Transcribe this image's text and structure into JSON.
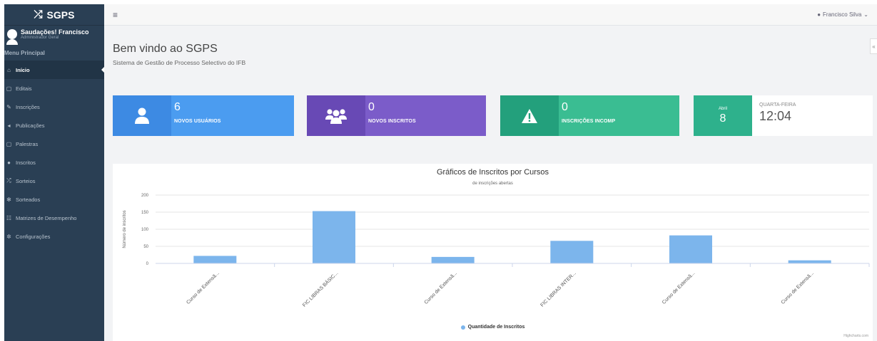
{
  "app": {
    "brand": "SGPS"
  },
  "sidebar": {
    "greeting": "Saudações! Francisco",
    "role": "Administrador Geral",
    "menu_title": "Menu Principal",
    "items": [
      {
        "label": "Início",
        "icon": "home-icon",
        "active": true
      },
      {
        "label": "Editais",
        "icon": "file-icon"
      },
      {
        "label": "Inscrições",
        "icon": "edit-icon"
      },
      {
        "label": "Publicações",
        "icon": "megaphone-icon"
      },
      {
        "label": "Palestras",
        "icon": "file-icon"
      },
      {
        "label": "Inscritos",
        "icon": "users-icon"
      },
      {
        "label": "Sorteios",
        "icon": "shuffle-icon"
      },
      {
        "label": "Sorteados",
        "icon": "gear-icon"
      },
      {
        "label": "Matrizes de Desempenho",
        "icon": "table-icon"
      },
      {
        "label": "Configurações",
        "icon": "cogs-icon"
      }
    ]
  },
  "header": {
    "user": "Francisco Silva"
  },
  "page": {
    "title": "Bem vindo ao SGPS",
    "subtitle": "Sistema de Gestão de Processo Selectivo do IFB"
  },
  "tiles": [
    {
      "value": "6",
      "label": "NOVOS USUÁRIOS",
      "icon": "user-icon"
    },
    {
      "value": "0",
      "label": "NOVOS INSCRITOS",
      "icon": "group-icon"
    },
    {
      "value": "0",
      "label": "INSCRIÇÕES INCOMP",
      "icon": "warning-icon"
    }
  ],
  "calendar": {
    "month": "Abril",
    "day": "8",
    "weekday": "QUARTA-FEIRA",
    "time": "12:04"
  },
  "colors": {
    "sidebar": "#2a3f54",
    "series": "#7cb5ec"
  },
  "chart_data": {
    "type": "bar",
    "title": "Gráficos de Inscritos por Cursos",
    "subtitle": "de inscrições abertas",
    "ylabel": "Número de inscritos",
    "ylim": [
      0,
      200
    ],
    "yticks": [
      0,
      50,
      100,
      150,
      200
    ],
    "categories": [
      "Curso de Extensã...",
      "FIC LIBRAS BÁSIC...",
      "Curso de Extensã...",
      "FIC LIBRAS INTER...",
      "Curso de Extensã...",
      "Curso de Extensã..."
    ],
    "series": [
      {
        "name": "Quantidade de Inscritos",
        "values": [
          22,
          153,
          19,
          66,
          82,
          9
        ]
      }
    ],
    "credits": "Highcharts.com"
  }
}
